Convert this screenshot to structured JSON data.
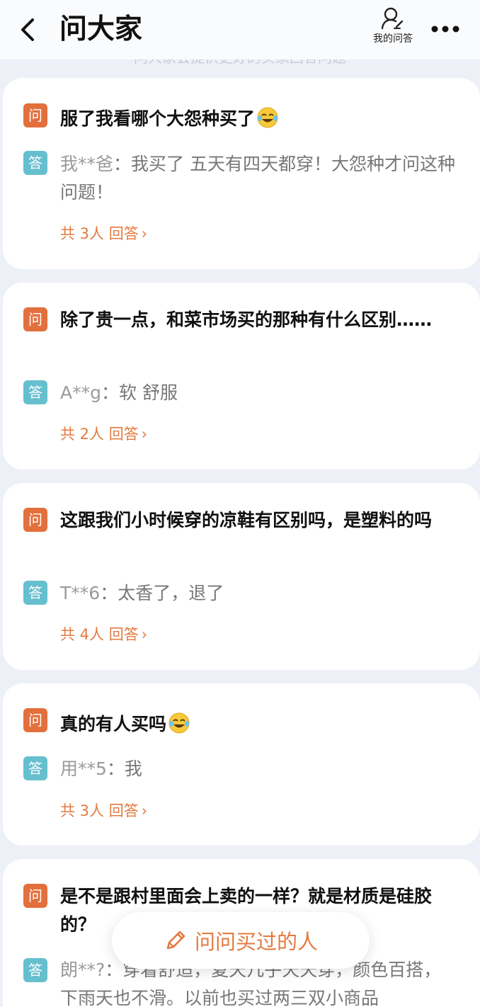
{
  "header": {
    "title": "问大家",
    "my_qa_label": "我的问答",
    "tip": "问大家会提供更好的买家回答问题"
  },
  "badges": {
    "question": "问",
    "answer": "答"
  },
  "colors": {
    "accent": "#e37a40",
    "question_badge": "#e36f3c",
    "answer_badge": "#66bfce"
  },
  "questions": [
    {
      "question": "服了我看哪个大怨种买了",
      "question_emoji": "laughing-tears-emoji",
      "answer_user": "我**爸",
      "answer_text": "我买了 五天有四天都穿！大怨种才问这种问题！",
      "count_label": "共 3人 回答"
    },
    {
      "question": "除了贵一点，和菜市场买的那种有什么区别……",
      "answer_user": "A**g",
      "answer_text": "软 舒服",
      "count_label": "共 2人 回答"
    },
    {
      "question": "这跟我们小时候穿的凉鞋有区别吗，是塑料的吗",
      "answer_user": "T**6",
      "answer_text": "太香了，退了",
      "count_label": "共 4人 回答"
    },
    {
      "question": "真的有人买吗",
      "question_emoji": "laughing-tears-emoji",
      "answer_user": "用**5",
      "answer_text": "我",
      "count_label": "共 3人 回答"
    },
    {
      "question": "是不是跟村里面会上卖的一样？就是材质是硅胶的？",
      "answer_user": "朗**?",
      "answer_text": "穿着舒适，夏天几乎天天穿，颜色百搭，下雨天也不滑。以前也买过两三双小商品"
    }
  ],
  "ask_button": {
    "label": "问问买过的人"
  }
}
